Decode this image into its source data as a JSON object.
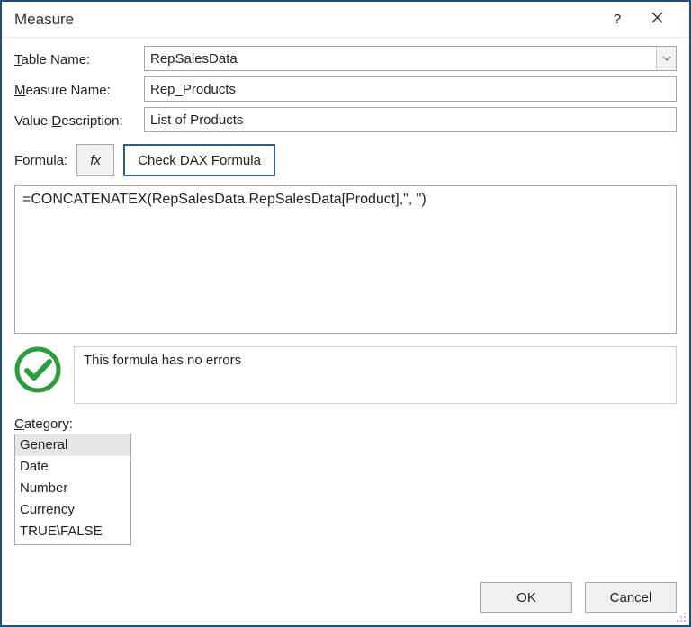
{
  "title": "Measure",
  "labels": {
    "table_name_pre": "T",
    "table_name_post": "able Name:",
    "measure_name_pre": "M",
    "measure_name_post": "easure Name:",
    "desc_pre": "Value ",
    "desc_ul": "D",
    "desc_post": "escription:",
    "formula_pre": "F",
    "formula_ul": "o",
    "formula_post": "rmula:",
    "fx": "fx",
    "check_dax": "Check DAX Formula",
    "category_ul": "C",
    "category_post": "ategory:"
  },
  "fields": {
    "table_name": "RepSalesData",
    "measure_name": "Rep_Products",
    "description": "List of Products",
    "formula": "=CONCATENATEX(RepSalesData,RepSalesData[Product],\", \")"
  },
  "status": {
    "message": "This formula has no errors"
  },
  "categories": {
    "items": [
      "General",
      "Date",
      "Number",
      "Currency",
      "TRUE\\FALSE"
    ],
    "selected_index": 0
  },
  "buttons": {
    "ok": "OK",
    "cancel": "Cancel"
  }
}
